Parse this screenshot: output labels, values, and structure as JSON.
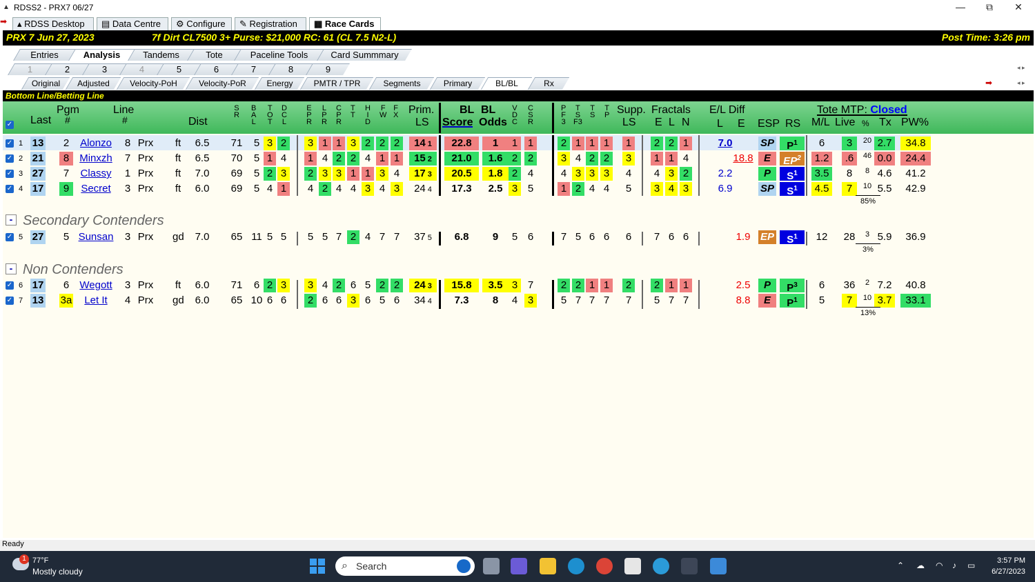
{
  "window": {
    "title": "RDSS2 - PRX7  06/27",
    "minimize": "—",
    "maximize": "⧉",
    "close": "✕"
  },
  "top_tabs": [
    "RDSS Desktop",
    "Data Centre",
    "Configure",
    "Registration",
    "Race Cards"
  ],
  "race": {
    "left": "PRX 7  Jun 27, 2023",
    "info": "7f Dirt  CL7500 3+  Purse: $21,000  RC: 61  (CL 7.5 N2-L)",
    "post": "Post Time: 3:26 pm"
  },
  "view_tabs": [
    "Entries",
    "Analysis",
    "Tandems",
    "Tote",
    "Paceline Tools",
    "Card Summmary"
  ],
  "race_tabs": [
    "1",
    "2",
    "3",
    "4",
    "5",
    "6",
    "7",
    "8",
    "9"
  ],
  "sub_tabs": [
    "Original",
    "Adjusted",
    "Velocity-PoH",
    "Velocity-PoR",
    "Energy",
    "PMTR / TPR",
    "Segments",
    "Primary",
    "BL/BL",
    "Rx"
  ],
  "section": "Bottom Line/Betting Line",
  "headers": {
    "last": "Last",
    "pgm": "Pgm",
    "pgm2": "#",
    "line": "Line",
    "line2": "#",
    "dist": "Dist",
    "sr": "S\nR",
    "bal": "B\nA\nL",
    "tot": "T\nO\nT",
    "dcl": "D\nC\nL",
    "epr": "E\nP\nR",
    "lpr": "L\nP\nR",
    "cpr": "C\nP\nR",
    "tt": "T\nT",
    "hid": "H\nI\nD",
    "fw": "F\nW",
    "fx": "F\nX",
    "prim": "Prim.",
    "prim2": "LS",
    "bl": "BL",
    "bl2": "BL",
    "score": "Score",
    "odds": "Odds",
    "vdc": "V\nD\nC",
    "csr": "C\nS\nR",
    "pf3": "P\nF\n3",
    "tsf3": "T\nS\nF3",
    "ts": "T\nS",
    "tp": "T\nP",
    "supp": "Supp.",
    "supp2": "LS",
    "frac": "Fractals",
    "e": "E",
    "l": "L",
    "n": "N",
    "eldiff": "E/L Diff",
    "ell": "L",
    "ele": "E",
    "esp": "ESP",
    "rs": "RS",
    "tote": "Tote MTP:",
    "closed": "Closed",
    "ml": "M/L",
    "live": "Live",
    "pct": "%",
    "tx": "Tx",
    "pw": "PW%"
  },
  "groups": {
    "secondary": "Secondary Contenders",
    "non": "Non Contenders"
  },
  "rows": [
    {
      "n": "1",
      "last": "13",
      "pgm": "2",
      "name": "Alonzo",
      "line": "8",
      "trk": "Prx",
      "cond": "ft",
      "dist": "6.5",
      "sr": "71",
      "bal": "5",
      "tot": "3",
      "dcl": "2",
      "epr": "3",
      "lpr": "1",
      "cpr": "1",
      "tt": "3",
      "hid": "2",
      "fw": "2",
      "fx": "2",
      "prim": "14",
      "prim_r": "1",
      "score": "22.8",
      "odds": "1",
      "vdc": "1",
      "csr": "1",
      "pf3": "2",
      "tsf3": "1",
      "ts": "1",
      "tp": "1",
      "supp": "1",
      "fe": "2",
      "fl": "2",
      "fn": "1",
      "ell": "7.0",
      "ele": "",
      "esp": "SP",
      "rs": "P",
      "rs_sup": "1",
      "ml": "6",
      "live": "3",
      "pct": "20",
      "tx": "2.7",
      "pw": "34.8",
      "under": ""
    },
    {
      "n": "2",
      "last": "21",
      "pgm": "8",
      "name": "Minxzh",
      "line": "7",
      "trk": "Prx",
      "cond": "ft",
      "dist": "6.5",
      "sr": "70",
      "bal": "5",
      "tot": "1",
      "dcl": "4",
      "epr": "1",
      "lpr": "4",
      "cpr": "2",
      "tt": "2",
      "hid": "4",
      "fw": "1",
      "fx": "1",
      "prim": "15",
      "prim_r": "2",
      "score": "21.0",
      "odds": "1.6",
      "vdc": "2",
      "csr": "2",
      "pf3": "3",
      "tsf3": "4",
      "ts": "2",
      "tp": "2",
      "supp": "3",
      "fe": "1",
      "fl": "1",
      "fn": "4",
      "ell": "",
      "ele": "18.8",
      "esp": "E",
      "rs": "EP",
      "rs_sup": "2",
      "ml": "1.2",
      "live": ".6",
      "pct": "46",
      "tx": "0.0",
      "pw": "24.4",
      "under": ""
    },
    {
      "n": "3",
      "last": "27",
      "pgm": "7",
      "name": "Classy",
      "line": "1",
      "trk": "Prx",
      "cond": "ft",
      "dist": "7.0",
      "sr": "69",
      "bal": "5",
      "tot": "2",
      "dcl": "3",
      "epr": "2",
      "lpr": "3",
      "cpr": "3",
      "tt": "1",
      "hid": "1",
      "fw": "3",
      "fx": "4",
      "prim": "17",
      "prim_r": "3",
      "score": "20.5",
      "odds": "1.8",
      "vdc": "2",
      "csr": "4",
      "pf3": "4",
      "tsf3": "3",
      "ts": "3",
      "tp": "3",
      "supp": "4",
      "fe": "4",
      "fl": "3",
      "fn": "2",
      "ell": "2.2",
      "ele": "",
      "esp": "P",
      "rs": "S",
      "rs_sup": "1",
      "ml": "3.5",
      "live": "8",
      "pct": "8",
      "tx": "4.6",
      "pw": "41.2",
      "under": ""
    },
    {
      "n": "4",
      "last": "17",
      "pgm": "9",
      "name": "Secret",
      "line": "3",
      "trk": "Prx",
      "cond": "ft",
      "dist": "6.0",
      "sr": "69",
      "bal": "5",
      "tot": "4",
      "dcl": "1",
      "epr": "4",
      "lpr": "2",
      "cpr": "4",
      "tt": "4",
      "hid": "3",
      "fw": "4",
      "fx": "3",
      "prim": "24",
      "prim_r": "4",
      "score": "17.3",
      "odds": "2.5",
      "vdc": "3",
      "csr": "5",
      "pf3": "1",
      "tsf3": "2",
      "ts": "4",
      "tp": "4",
      "supp": "5",
      "fe": "3",
      "fl": "4",
      "fn": "3",
      "ell": "6.9",
      "ele": "",
      "esp": "SP",
      "rs": "S",
      "rs_sup": "1",
      "ml": "4.5",
      "live": "7",
      "pct": "10",
      "tx": "5.5",
      "pw": "42.9",
      "under": "85%"
    },
    {
      "n": "5",
      "last": "27",
      "pgm": "5",
      "name": "Sunsan",
      "line": "3",
      "trk": "Prx",
      "cond": "gd",
      "dist": "7.0",
      "sr": "65",
      "bal": "11",
      "tot": "5",
      "dcl": "5",
      "epr": "5",
      "lpr": "5",
      "cpr": "7",
      "tt": "2",
      "hid": "4",
      "fw": "7",
      "fx": "7",
      "prim": "37",
      "prim_r": "5",
      "score": "6.8",
      "odds": "9",
      "vdc": "5",
      "csr": "6",
      "pf3": "7",
      "tsf3": "5",
      "ts": "6",
      "tp": "6",
      "supp": "6",
      "fe": "7",
      "fl": "6",
      "fn": "6",
      "ell": "",
      "ele": "1.9",
      "esp": "EP",
      "rs": "S",
      "rs_sup": "1",
      "ml": "12",
      "live": "28",
      "pct": "3",
      "tx": "5.9",
      "pw": "36.9",
      "under": "3%"
    },
    {
      "n": "6",
      "last": "17",
      "pgm": "6",
      "name": "Wegott",
      "line": "3",
      "trk": "Prx",
      "cond": "ft",
      "dist": "6.0",
      "sr": "71",
      "bal": "6",
      "tot": "2",
      "dcl": "3",
      "epr": "3",
      "lpr": "4",
      "cpr": "2",
      "tt": "6",
      "hid": "5",
      "fw": "2",
      "fx": "2",
      "prim": "24",
      "prim_r": "3",
      "score": "15.8",
      "odds": "3.5",
      "vdc": "3",
      "csr": "7",
      "pf3": "2",
      "tsf3": "2",
      "ts": "1",
      "tp": "1",
      "supp": "2",
      "fe": "2",
      "fl": "1",
      "fn": "1",
      "ell": "",
      "ele": "2.5",
      "esp": "P",
      "rs": "P",
      "rs_sup": "3",
      "ml": "6",
      "live": "36",
      "pct": "2",
      "tx": "7.2",
      "pw": "40.8",
      "under": ""
    },
    {
      "n": "7",
      "last": "13",
      "pgm": "3a",
      "name": "Let It",
      "line": "4",
      "trk": "Prx",
      "cond": "gd",
      "dist": "6.0",
      "sr": "65",
      "bal": "10",
      "tot": "6",
      "dcl": "6",
      "epr": "2",
      "lpr": "6",
      "cpr": "6",
      "tt": "3",
      "hid": "6",
      "fw": "5",
      "fx": "6",
      "prim": "34",
      "prim_r": "4",
      "score": "7.3",
      "odds": "8",
      "vdc": "4",
      "csr": "3",
      "pf3": "5",
      "tsf3": "7",
      "ts": "7",
      "tp": "7",
      "supp": "7",
      "fe": "5",
      "fl": "7",
      "fn": "7",
      "ell": "",
      "ele": "8.8",
      "esp": "E",
      "rs": "P",
      "rs_sup": "1",
      "ml": "5",
      "live": "7",
      "pct": "10",
      "tx": "3.7",
      "pw": "33.1",
      "under": "13%"
    }
  ],
  "status": "Ready",
  "taskbar": {
    "temp": "77°F",
    "weather": "Mostly cloudy",
    "badge": "1",
    "search": "Search",
    "time": "3:57 PM",
    "date": "6/27/2023"
  }
}
